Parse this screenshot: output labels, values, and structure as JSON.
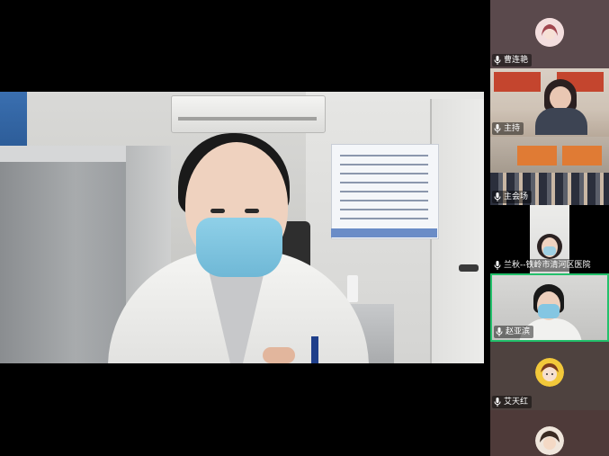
{
  "meeting": {
    "participants": [
      {
        "name": "曹连艳",
        "mic": "mic-icon",
        "view": "avatar"
      },
      {
        "name": "主持",
        "mic": "mic-icon",
        "view": "video"
      },
      {
        "name": "主会场",
        "mic": "mic-icon",
        "view": "video"
      },
      {
        "name": "兰秋--铁岭市清河区医院",
        "mic": "mic-icon",
        "view": "video"
      },
      {
        "name": "赵亚滨",
        "mic": "mic-icon",
        "view": "video",
        "speaking": true
      },
      {
        "name": "艾天红",
        "mic": "mic-icon",
        "view": "avatar"
      },
      {
        "name": "",
        "mic": "",
        "view": "avatar"
      }
    ]
  },
  "colors": {
    "speaking_border": "#23c06b",
    "panel_bg": "#1c1a1b",
    "mask_blue": "#84c6e2"
  }
}
